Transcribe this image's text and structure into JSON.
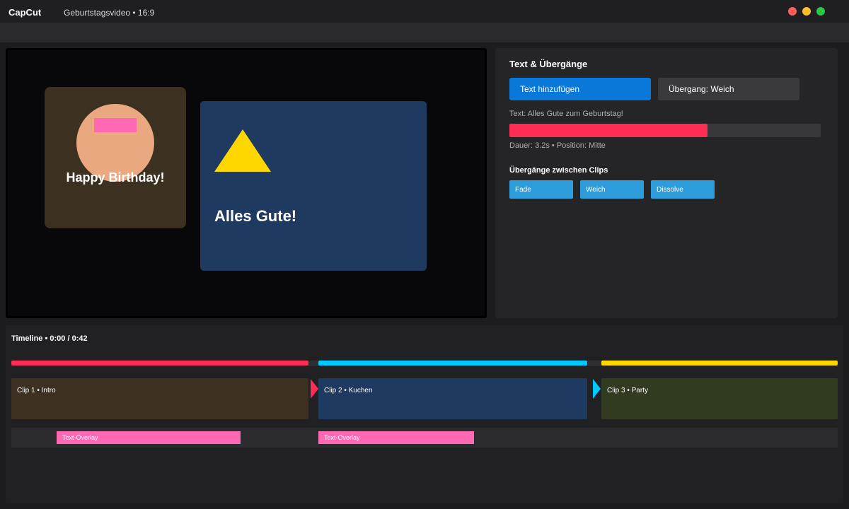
{
  "app": {
    "name": "CapCut",
    "document_title": "Geburtstagsvideo • 16:9"
  },
  "window_controls": {
    "close_color": "#ff5f57",
    "minimize_color": "#febc2e",
    "maximize_color": "#28c840"
  },
  "preview": {
    "card1": {
      "text": "Happy Birthday!"
    },
    "card2": {
      "text": "Alles Gute!"
    }
  },
  "panel": {
    "title": "Text & Übergänge",
    "add_text_label": "Text hinzufügen",
    "transition_label": "Übergang: Weich",
    "text_info": "Text: Alles Gute zum Geburtstag!",
    "progress_fraction": 0.636,
    "meta_info": "Dauer: 3.2s • Position: Mitte",
    "transitions_title": "Übergänge zwischen Clips",
    "transition_chips": [
      "Fade",
      "Weich",
      "Dissolve"
    ]
  },
  "timeline": {
    "title": "Timeline • 0:00 / 0:42",
    "clips": [
      {
        "label": "Clip 1 • Intro",
        "color": "#3d3020",
        "accent": "#ff2d55"
      },
      {
        "label": "Clip 2 • Kuchen",
        "color": "#1e3a60",
        "accent": "#00c8ff"
      },
      {
        "label": "Clip 3 • Party",
        "color": "#313b20",
        "accent": "#ffd700"
      }
    ],
    "overlays": [
      {
        "label": "Text-Overlay"
      },
      {
        "label": "Text-Overlay"
      }
    ]
  },
  "colors": {
    "primary": "#0a78d8",
    "accent_red": "#ff2d55",
    "chip": "#2d9cdb",
    "overlay": "#ff69b4"
  }
}
